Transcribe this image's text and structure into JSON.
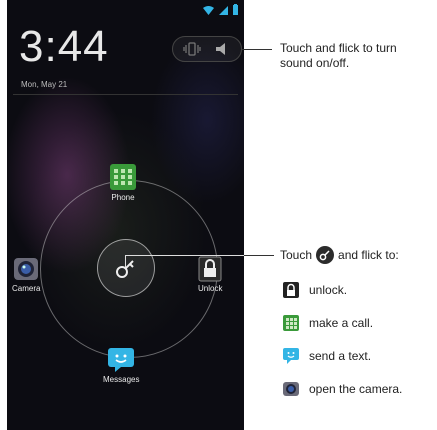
{
  "lockscreen": {
    "time": "3:44",
    "date": "Mon, May 21",
    "targets": {
      "phone": "Phone",
      "camera": "Camera",
      "unlock": "Unlock",
      "messages": "Messages"
    }
  },
  "callouts": {
    "sound": "Touch and flick to turn sound on/off.",
    "touch_prefix": "Touch",
    "touch_suffix": "and flick to:",
    "items": [
      {
        "icon": "lock-icon",
        "text": "unlock."
      },
      {
        "icon": "phone-app-icon",
        "text": "make a call."
      },
      {
        "icon": "messages-app-icon",
        "text": "send a text."
      },
      {
        "icon": "camera-app-icon",
        "text": "open the camera."
      }
    ]
  }
}
